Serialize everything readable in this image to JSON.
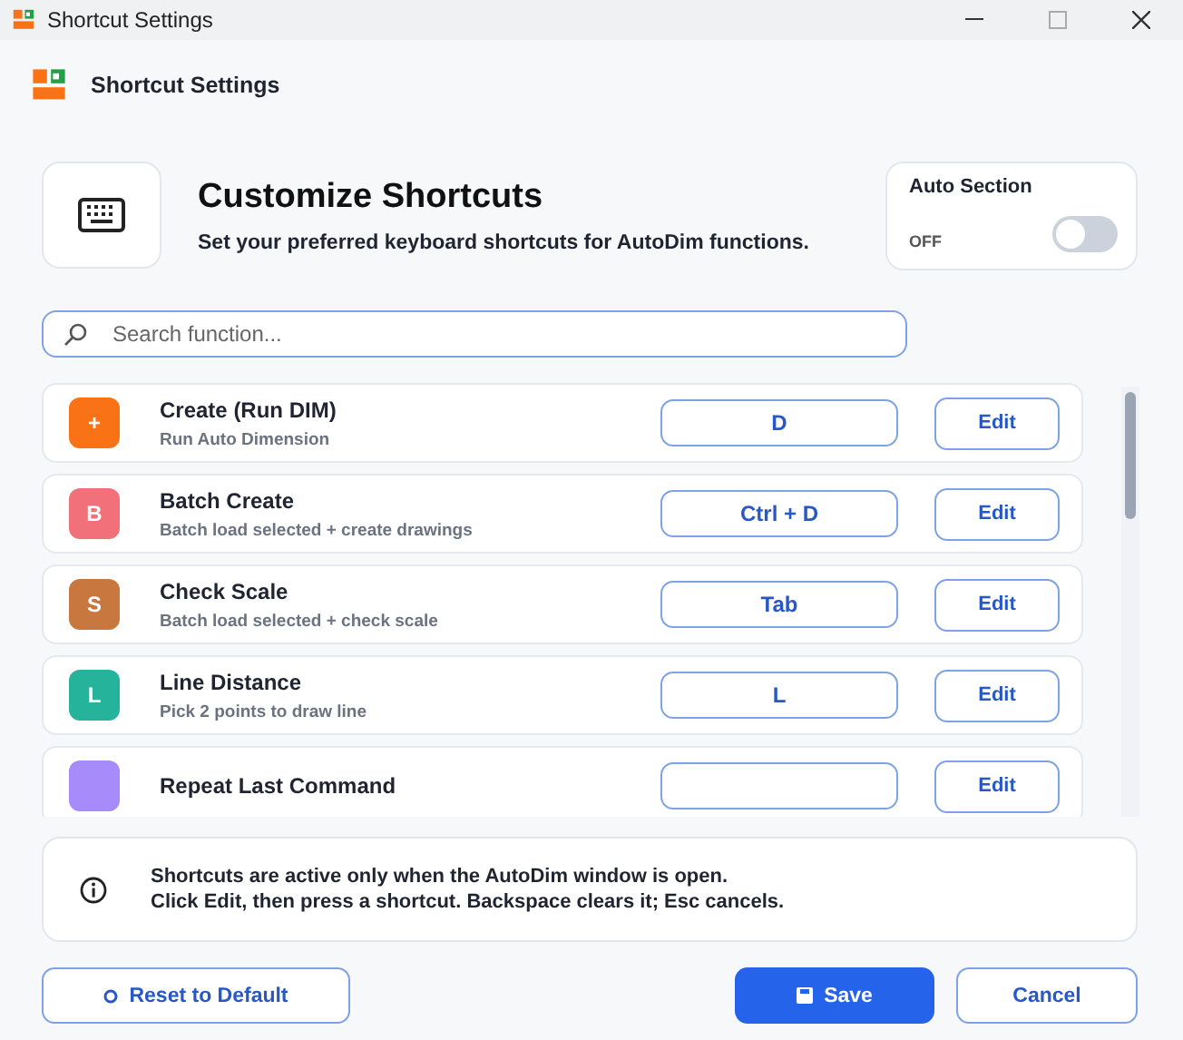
{
  "window": {
    "title": "Shortcut Settings"
  },
  "header": {
    "title": "Shortcut Settings"
  },
  "intro": {
    "title": "Customize Shortcuts",
    "subtitle": "Set your preferred keyboard shortcuts for AutoDim functions."
  },
  "auto_section": {
    "label": "Auto Section",
    "state_text": "OFF",
    "on": false
  },
  "search": {
    "placeholder": "Search function..."
  },
  "shortcuts": [
    {
      "badge": "+",
      "color": "#f97316",
      "title": "Create (Run DIM)",
      "description": "Run Auto Dimension",
      "key": "D",
      "action": "Edit"
    },
    {
      "badge": "B",
      "color": "#f1707a",
      "title": "Batch Create",
      "description": "Batch load selected + create drawings",
      "key": "Ctrl + D",
      "action": "Edit"
    },
    {
      "badge": "S",
      "color": "#c8773f",
      "title": "Check Scale",
      "description": "Batch load selected + check scale",
      "key": "Tab",
      "action": "Edit"
    },
    {
      "badge": "L",
      "color": "#26b39c",
      "title": "Line Distance",
      "description": "Pick 2 points to draw line",
      "key": "L",
      "action": "Edit"
    },
    {
      "color": "#a78bfa",
      "title": "Repeat Last Command",
      "action": "Edit"
    }
  ],
  "info": {
    "lines": [
      "Shortcuts are active only when the AutoDim window is open.",
      "Click Edit, then press a shortcut. Backspace clears it; Esc cancels."
    ]
  },
  "buttons": [
    {
      "kind": "secondary",
      "label": "Reset to Default"
    },
    {
      "kind": "primary",
      "label": "Save"
    },
    {
      "kind": "secondary",
      "label": "Cancel"
    }
  ]
}
